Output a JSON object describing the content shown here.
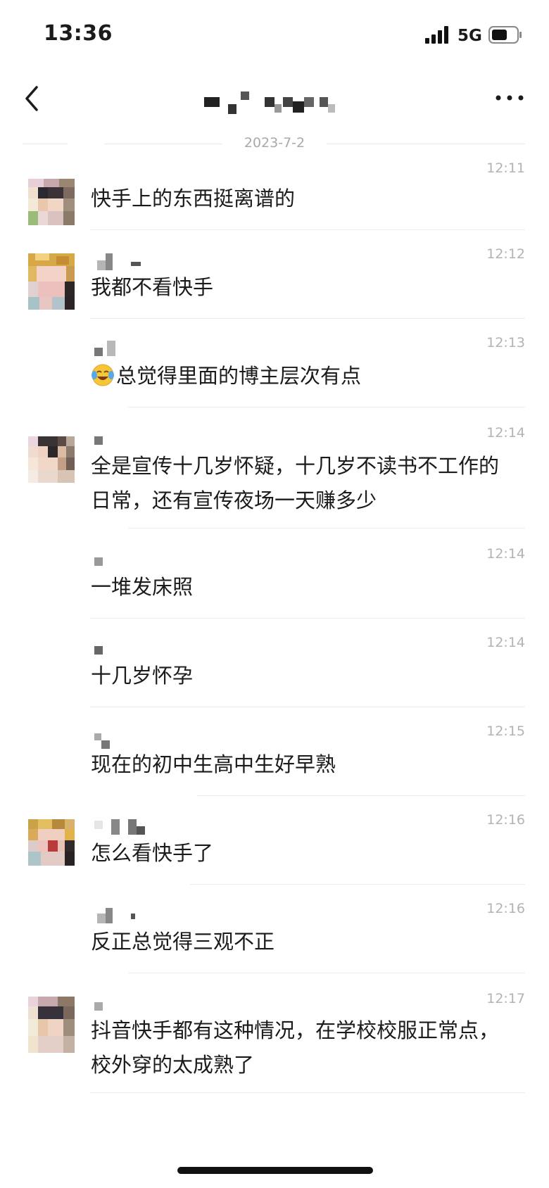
{
  "status": {
    "time": "13:36",
    "network": "5G"
  },
  "nav": {
    "title": ""
  },
  "date_separator": "2023-7-2",
  "messages": [
    {
      "time": "12:11",
      "text": "快手上的东西挺离谱的"
    },
    {
      "time": "12:12",
      "text": "我都不看快手"
    },
    {
      "time": "12:13",
      "text": "总觉得里面的博主层次有点",
      "emoji": "face-with-tears-of-joy-icon"
    },
    {
      "time": "12:14",
      "text": "全是宣传十几岁怀疑，十几岁不读书不工作的日常，还有宣传夜场一天赚多少"
    },
    {
      "time": "12:14",
      "text": "一堆发床照"
    },
    {
      "time": "12:14",
      "text": "十几岁怀孕"
    },
    {
      "time": "12:15",
      "text": "现在的初中生高中生好早熟"
    },
    {
      "time": "12:16",
      "text": "怎么看快手了"
    },
    {
      "time": "12:16",
      "text": "反正总觉得三观不正"
    },
    {
      "time": "12:17",
      "text": "抖音快手都有这种情况，在学校校服正常点，校外穿的太成熟了"
    }
  ],
  "colors": {
    "timestamp": "#b3b3b3",
    "text": "#1b1b1b",
    "divider": "#ececec"
  }
}
